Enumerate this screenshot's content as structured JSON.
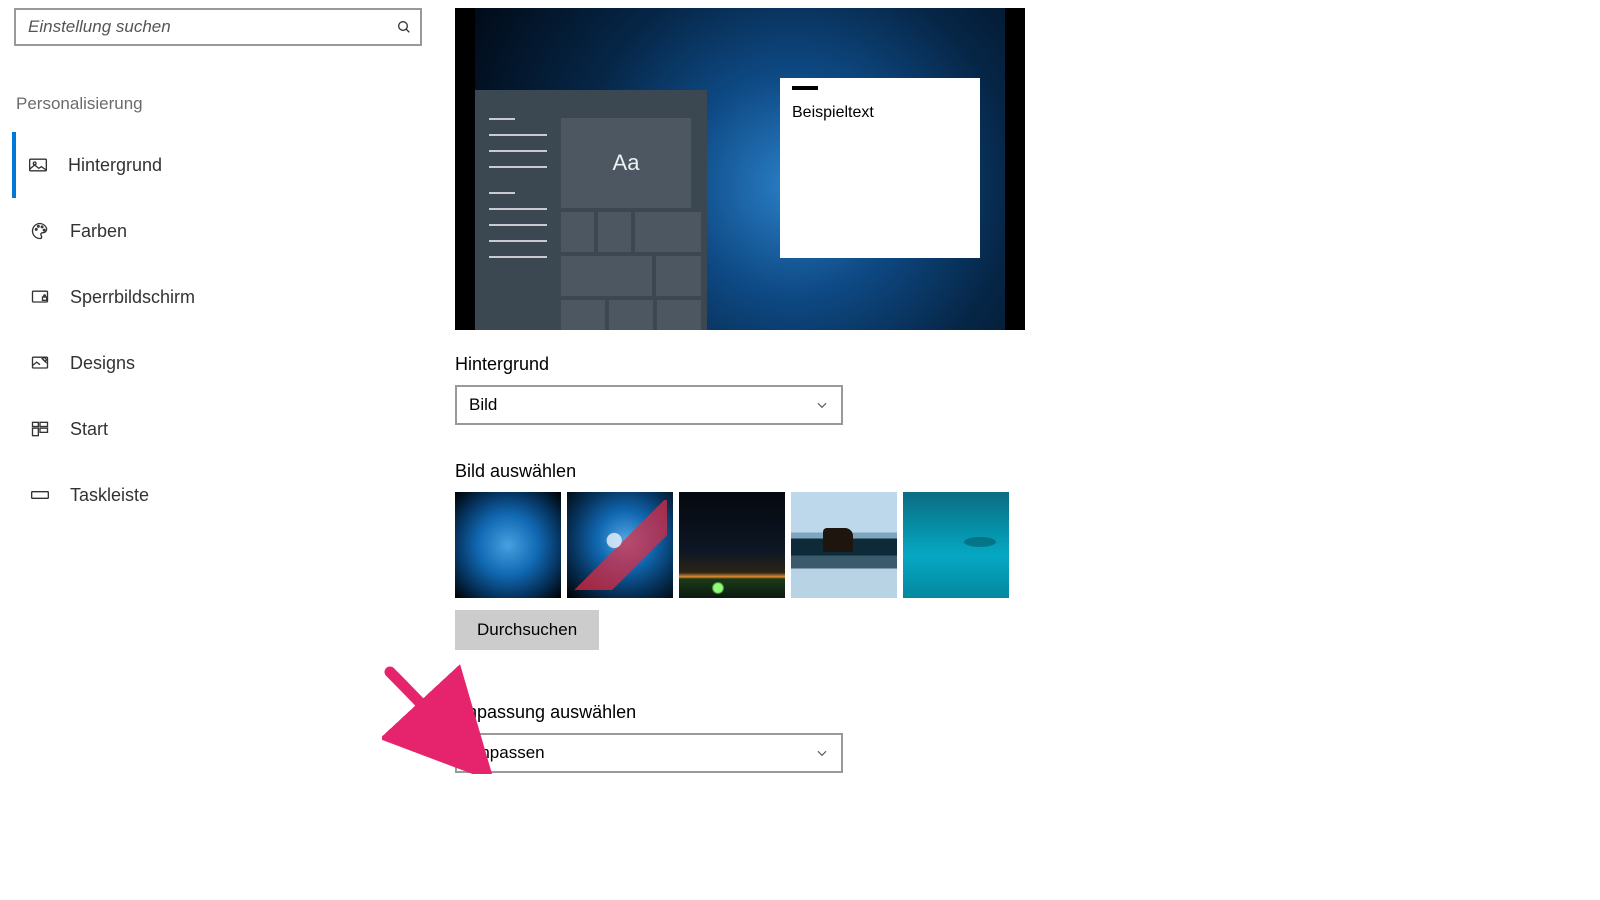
{
  "search": {
    "placeholder": "Einstellung suchen"
  },
  "category": "Personalisierung",
  "nav": [
    {
      "label": "Hintergrund"
    },
    {
      "label": "Farben"
    },
    {
      "label": "Sperrbildschirm"
    },
    {
      "label": "Designs"
    },
    {
      "label": "Start"
    },
    {
      "label": "Taskleiste"
    }
  ],
  "preview": {
    "sample_text": "Beispieltext",
    "tile_letters": "Aa"
  },
  "background_section": {
    "label": "Hintergrund",
    "combo_value": "Bild"
  },
  "choose_image": {
    "label": "Bild auswählen",
    "browse": "Durchsuchen"
  },
  "fit_section": {
    "label": "Anpassung auswählen",
    "combo_value": "Anpassen"
  },
  "colors": {
    "accent": "#0078d7",
    "arrow": "#e6236d"
  }
}
